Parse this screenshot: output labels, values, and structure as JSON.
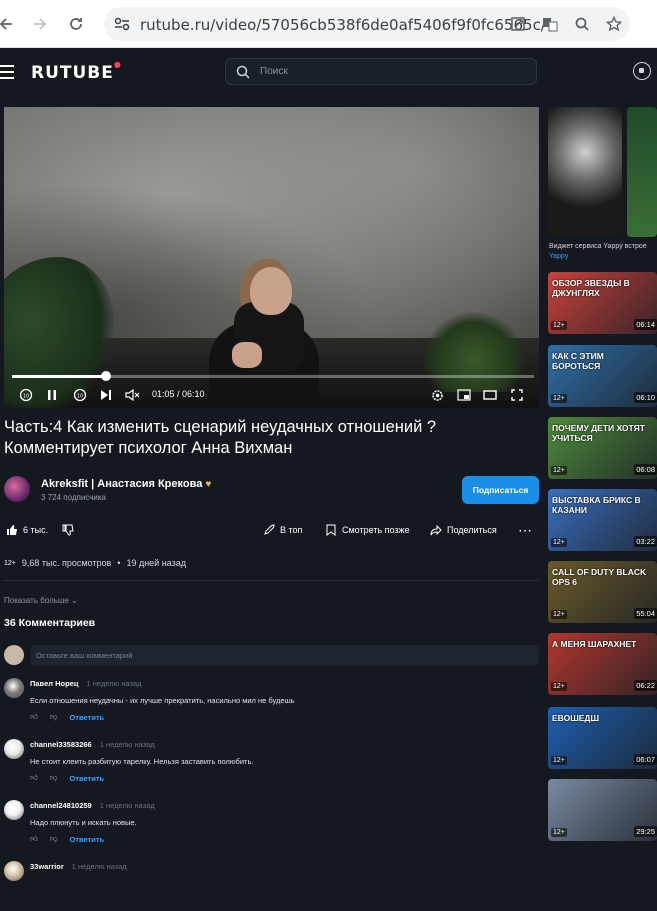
{
  "browser": {
    "url": "rutube.ru/video/57056cb538f6de0af5406f9f0fc6565c/"
  },
  "header": {
    "logo": "RUTUBE",
    "search_placeholder": "Поиск"
  },
  "player": {
    "time": "01:05 / 06:10",
    "progress": 0.18
  },
  "video": {
    "title": "Часть:4 Как изменить сценарий неудачных отношений ? Комментирует психолог Анна Вихман",
    "channel": "Akreksfit | Анастасия Крекова",
    "subscribers": "3 724 подписчика",
    "subscribe_label": "Подписаться",
    "likes": "6 тыс.",
    "to_top": "В топ",
    "watch_later": "Смотреть позже",
    "share": "Поделиться",
    "age": "12+",
    "views": "9,68 тыс. просмотров",
    "published": "19 дней назад",
    "show_more": "Показать больше"
  },
  "comments": {
    "title": "36 Комментариев",
    "input_placeholder": "Оставьте ваш комментарий",
    "reply_label": "Ответить",
    "items": [
      {
        "author": "Павел Норец",
        "date": "1 неделю назад",
        "text": "Если отношения неудачны - их лучше прекратить, насильно мил не будешь",
        "color": "#7a7a7a"
      },
      {
        "author": "channel33583266",
        "date": "1 неделю назад",
        "text": "Не стоит клеить разбитую тарелку. Нельзя заставить полюбить.",
        "color": "#e8e8e8"
      },
      {
        "author": "channel24810259",
        "date": "1 неделю назад",
        "text": "Надо плюнуть и искать новые.",
        "color": "#f0f0f0"
      },
      {
        "author": "33warrior",
        "date": "1 неделю назад",
        "text": "",
        "color": "#d0c0a0"
      }
    ]
  },
  "sidebar": {
    "promo_caption": "Виджет сервиса Yappy встрое",
    "promo_source": "Yappy",
    "thumbs": [
      {
        "caption": "ОБЗОР ЗВЕЗДЫ В ДЖУНГЛЯХ",
        "age": "12+",
        "duration": "06:14",
        "color": "#c9413a"
      },
      {
        "caption": "КАК С ЭТИМ БОРОТЬСЯ",
        "age": "12+",
        "duration": "06:10",
        "color": "#2f6fa8"
      },
      {
        "caption": "ПОЧЕМУ ДЕТИ ХОТЯТ УЧИТЬСЯ",
        "age": "12+",
        "duration": "06:08",
        "color": "#4f8a3c"
      },
      {
        "caption": "ВЫСТАВКА БРИКС В КАЗАНИ",
        "age": "12+",
        "duration": "03:22",
        "color": "#3a6fbf"
      },
      {
        "caption": "CALL OF DUTY BLACK OPS 6",
        "age": "12+",
        "duration": "55:04",
        "color": "#6a5a2a"
      },
      {
        "caption": "А МЕНЯ ШАРАХНЕТ",
        "age": "12+",
        "duration": "06:22",
        "color": "#b2372f"
      },
      {
        "caption": "ЕВОШЕДШ",
        "age": "12+",
        "duration": "06:07",
        "color": "#1e5fb0"
      },
      {
        "caption": "",
        "age": "12+",
        "duration": "29:25",
        "color": "#7a8aa2"
      }
    ]
  }
}
